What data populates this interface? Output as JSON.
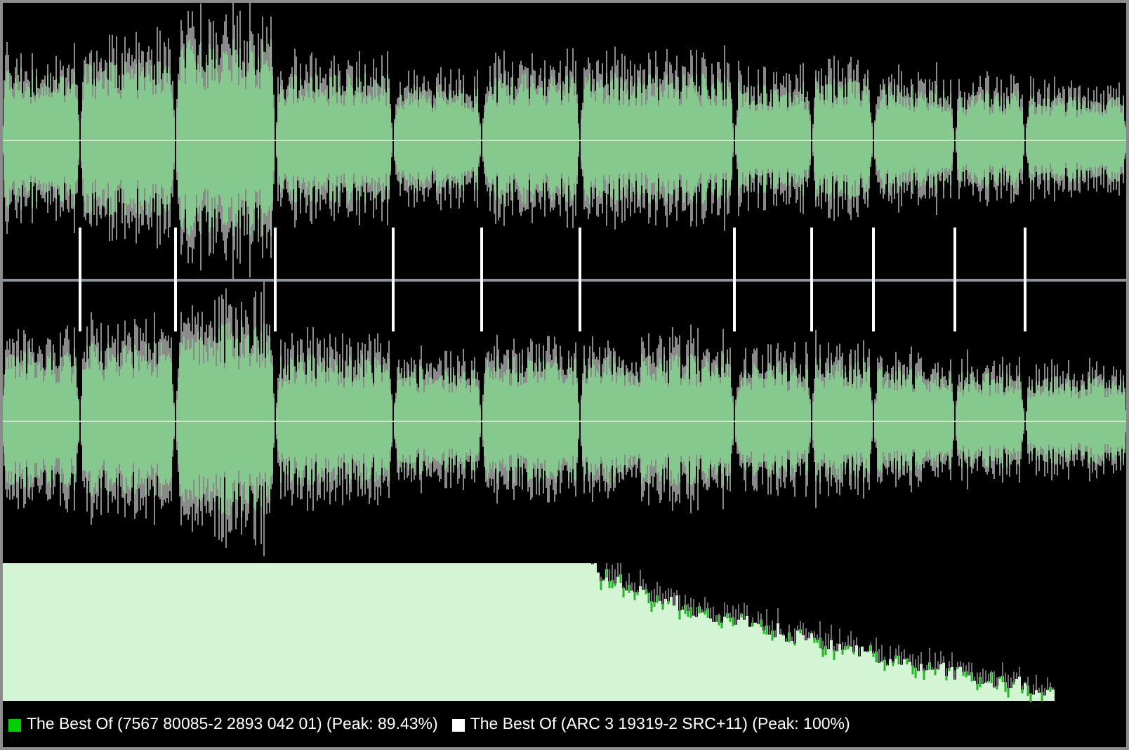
{
  "legend": [
    {
      "label": "The Best Of (7567 80085-2 2893 042 01) (Peak: 89.43%)",
      "color": "#00d000"
    },
    {
      "label": "The Best Of (ARC 3 19319-2 SRC+11) (Peak: 100%)",
      "color": "#ffffff"
    }
  ]
}
